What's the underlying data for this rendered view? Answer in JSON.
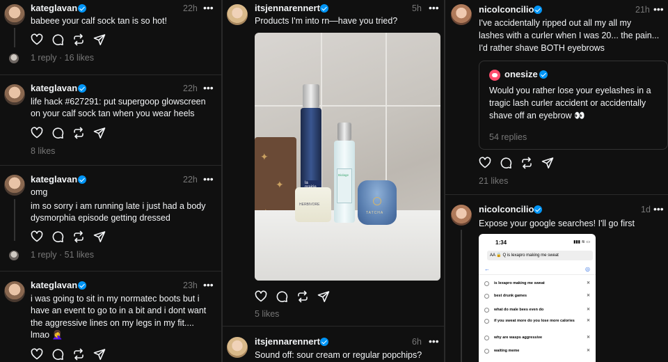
{
  "col1": {
    "posts": [
      {
        "username": "kateglavan",
        "time": "22h",
        "text": "babeee your calf sock tan is so hot!",
        "meta": "1 reply · 16 likes"
      },
      {
        "username": "kateglavan",
        "time": "22h",
        "text_lines": [
          "life hack #627291: put supergoop glowscreen",
          "on your calf sock tan when you wear heels"
        ],
        "meta": "8 likes"
      },
      {
        "username": "kateglavan",
        "time": "22h",
        "text_lines": [
          "omg",
          "im so sorry i am running late i just had a body",
          "dysmorphia episode getting dressed"
        ],
        "meta": "1 reply · 51 likes"
      },
      {
        "username": "kateglavan",
        "time": "23h",
        "text_lines": [
          "i was going to sit in my normatec boots but i",
          "have an event to go to in a bit and i dont want",
          "the aggressive lines on my legs in my fit....",
          "lmao 🤦‍♀️"
        ]
      }
    ]
  },
  "col2": {
    "posts": [
      {
        "username": "itsjennarennert",
        "time": "5h",
        "text": "Products I'm into rn—have you tried?",
        "meta": "5 likes",
        "photo_labels": {
          "bottle1": "la prairie",
          "jar1": "HERBIVORE",
          "bottle2": "Biolage",
          "jar2": "TATCHA"
        }
      },
      {
        "username": "itsjennarennert",
        "time": "6h",
        "text": "Sound off: sour cream or regular popchips?"
      }
    ]
  },
  "col3": {
    "posts": [
      {
        "username": "nicolconcilio",
        "time": "21h",
        "text_lines": [
          "I've accidentally ripped out all my all my",
          "lashes with a curler when I was 20... the pain...",
          "I'd rather shave BOTH eyebrows"
        ],
        "meta": "21 likes",
        "embed": {
          "username": "onesize",
          "text_lines": [
            "Would you rather lose your eyelashes in a",
            "tragic lash curler accident or accidentally",
            "shave off an eyebrow 👀"
          ],
          "meta": "54 replies"
        }
      },
      {
        "username": "nicolconcilio",
        "time": "1d",
        "text": "Expose your google searches! I'll go first",
        "phone": {
          "time": "1:34",
          "status": "▮▮▮ ≋ ▭",
          "search": "AA  🔒 Q is lexapro making me sweat",
          "items": [
            "is lexapro making me sweat",
            "best drunk games",
            "what do male bees even do",
            "if you sweat more do you lose more calories",
            "why are wasps aggressive",
            "waiting meme"
          ]
        }
      }
    ]
  },
  "more_icon": "•••",
  "colors": {
    "bg": "#101010",
    "text": "#f3f5f7",
    "muted": "#777777",
    "verified": "#0095f6",
    "divider": "#2a2a2a"
  }
}
